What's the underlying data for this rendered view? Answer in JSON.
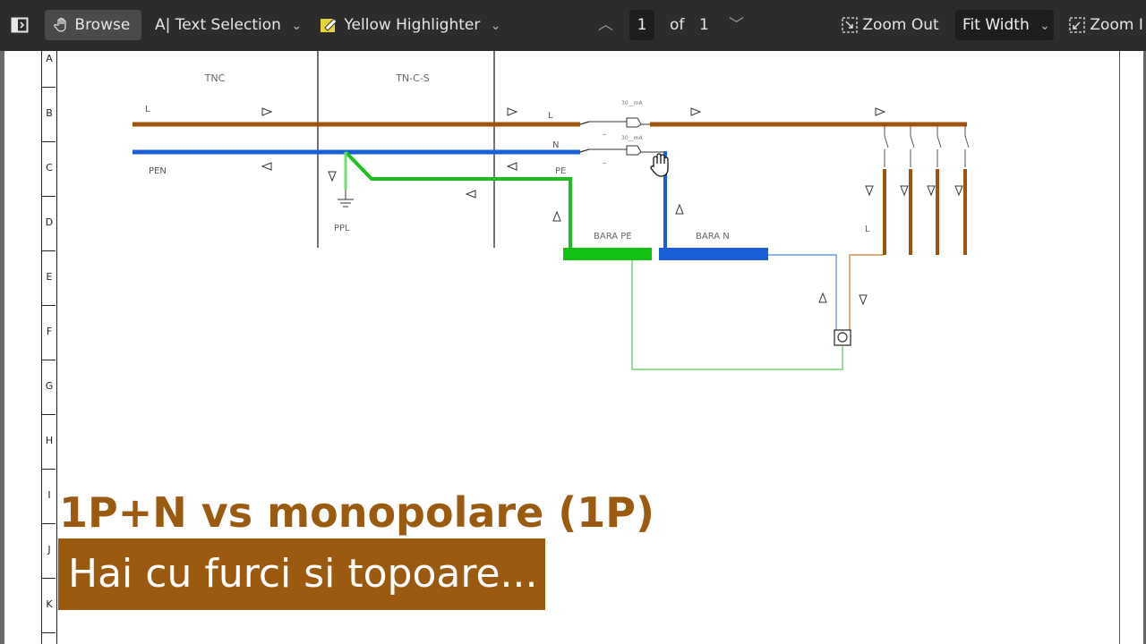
{
  "toolbar": {
    "browse_label": "Browse",
    "text_selection_label": "Text Selection",
    "highlighter_label": "Yellow Highlighter",
    "page_current": "1",
    "page_of": "of",
    "page_total": "1",
    "zoom_out_label": "Zoom Out",
    "fit_label": "Fit Width",
    "zoom_in_label": "Zoom I"
  },
  "ruler": {
    "rows": [
      "A",
      "B",
      "C",
      "D",
      "E",
      "F",
      "G",
      "H",
      "I",
      "J",
      "K"
    ]
  },
  "diagram": {
    "tnc": "TNC",
    "tncs": "TN-C-S",
    "l_left": "L",
    "pen": "PEN",
    "ppl": "PPL",
    "l_mid": "L",
    "n_mid": "N",
    "pe_mid": "PE",
    "rcd_top": "30__mA",
    "rcd_bottom": "30__mA",
    "bara_pe": "BARA PE",
    "bara_n": "BARA N",
    "l_right": "L",
    "colors": {
      "phase": "#a0520f",
      "neutral": "#1a5fd6",
      "pe": "#1ec01e"
    }
  },
  "caption": {
    "title": "1P+N vs monopolare (1P)",
    "subtitle": "Hai cu furci si topoare..."
  }
}
